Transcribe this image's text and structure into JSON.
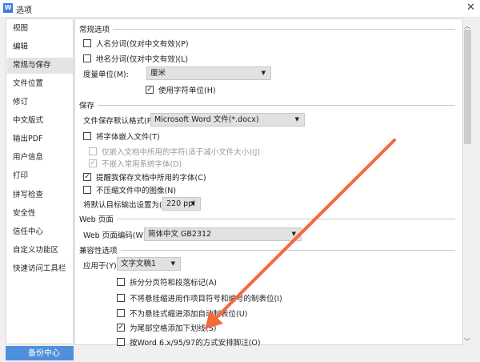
{
  "window": {
    "title": "选项",
    "app_icon": "W",
    "close": "✕"
  },
  "sidebar": {
    "items": [
      "视图",
      "编辑",
      "常规与保存",
      "文件位置",
      "修订",
      "中文版式",
      "输出PDF",
      "用户信息",
      "打印",
      "拼写检查",
      "安全性",
      "信任中心",
      "自定义功能区",
      "快速访问工具栏"
    ],
    "selected": "常规与保存",
    "backup": "备份中心"
  },
  "general": {
    "header": "常规选项",
    "name_seg": "人名分词(仅对中文有效)(P)",
    "place_seg": "地名分词(仅对中文有效)(L)",
    "unit_label": "度量单位(M):",
    "unit_value": "厘米",
    "char_unit": "使用字符单位(H)"
  },
  "save": {
    "header": "保存",
    "format_label": "文件保存默认格式(F):",
    "format_value": "Microsoft Word 文件(*.docx)",
    "embed_fonts": "将字体嵌入文件(T)",
    "embed_used_only": "仅嵌入文档中所用的字符(适于减小文件大小)(J)",
    "no_embed_system": "不嵌入常用系统字体(D)",
    "remind_fonts": "提醒我保存文档中所用的字体(C)",
    "no_compress": "不压缩文件中的图像(N)",
    "ppi_label": "将默认目标输出设置为(P):",
    "ppi_value": "220 ppi"
  },
  "web": {
    "header": "Web 页面",
    "encoding_label": "Web 页面编码(W):",
    "encoding_value": "简体中文 GB2312"
  },
  "compat": {
    "header": "兼容性选项",
    "apply_label": "应用于(Y):",
    "apply_value": "文字文稿1",
    "options": [
      {
        "label": "拆分分页符和段落标记(A)",
        "checked": false
      },
      {
        "label": "不将悬挂缩进用作项目符号和编号的制表位(I)",
        "checked": false
      },
      {
        "label": "不为悬挂式缩进添加自动制表位(U)",
        "checked": false
      },
      {
        "label": "为尾部空格添加下划线(S)",
        "checked": true
      },
      {
        "label": "按Word 6.x/95/97的方式安排脚注(O)",
        "checked": false
      }
    ]
  },
  "annotation": {
    "arrow_color": "#f26b3a"
  }
}
